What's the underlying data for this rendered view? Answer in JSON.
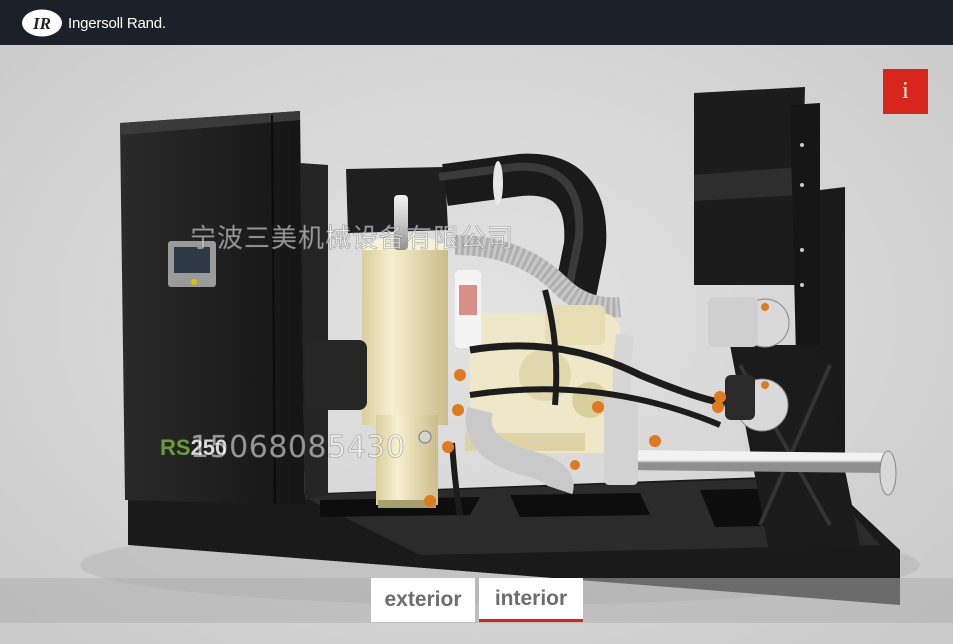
{
  "header": {
    "brand_name": "Ingersoll Rand.",
    "brand_mark": "IR"
  },
  "info_button": {
    "label": "i",
    "color": "#d9261c"
  },
  "watermark": {
    "company": "宁波三美机械设备有限公司",
    "phone": "15068085430"
  },
  "model": {
    "prefix": "RS",
    "number": "250"
  },
  "views": {
    "exterior_label": "exterior",
    "interior_label": "interior",
    "active": "interior"
  },
  "colors": {
    "header_bg": "#1c2129",
    "accent": "#d9261c",
    "cabinet": "#1e1e1e",
    "tank": "#efe6c2"
  }
}
